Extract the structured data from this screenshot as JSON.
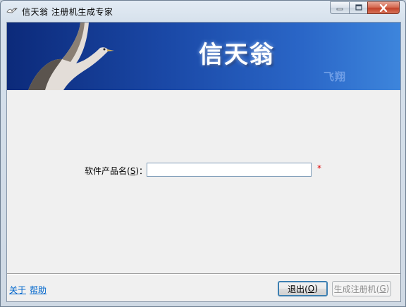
{
  "window": {
    "title": "信天翁 注册机生成专家",
    "icon": "seagull-icon"
  },
  "title_controls": {
    "minimize": "minimize-icon",
    "maximize": "maximize-icon",
    "close": "close-icon"
  },
  "banner": {
    "title": "信天翁",
    "subtitle": "飞翔",
    "colors": {
      "dark": "#0c2a7a",
      "light": "#3d85dc"
    }
  },
  "form": {
    "product_label_prefix": "软件产品名(",
    "product_label_mnemonic": "S",
    "product_label_suffix": ")：",
    "product_value": "",
    "required_mark": "*"
  },
  "footer": {
    "about_link": "关于",
    "help_link": "帮助",
    "exit_prefix": "退出(",
    "exit_mnemonic": "O",
    "exit_suffix": ")",
    "generate_prefix": "生成注册机(",
    "generate_mnemonic": "G",
    "generate_suffix": ")",
    "generate_enabled": false
  }
}
